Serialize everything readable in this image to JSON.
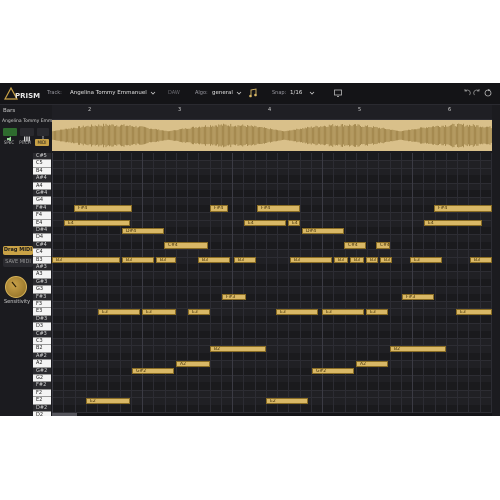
{
  "app": {
    "name": "PRISM"
  },
  "toolbar": {
    "track_label": "Track:",
    "track_value": "Angelina  Tommy Emmanuel",
    "daw_label": "DAW",
    "algo_label": "Algo:",
    "algo_value": "general",
    "snap_label": "Snap:",
    "snap_value": "1/16"
  },
  "sidebar": {
    "bars_label": "Bars",
    "track_name": "Angelina  Tommy Emma...",
    "buttons": [
      "SPEC",
      "PITCH",
      "MIDI"
    ],
    "drag_midi": "Drag MIDI",
    "save_midi": "SAVE MIDI",
    "sensitivity": "Sensitivity"
  },
  "ruler": {
    "marks": [
      "2",
      "3",
      "4",
      "5",
      "6"
    ]
  },
  "piano_keys": [
    "C#5",
    "C5",
    "B4",
    "A#4",
    "A4",
    "G#4",
    "G4",
    "F#4",
    "F4",
    "E4",
    "D#4",
    "D4",
    "C#4",
    "C4",
    "B3",
    "A#3",
    "A3",
    "G#3",
    "G3",
    "F#3",
    "F3",
    "E3",
    "D#3",
    "D3",
    "C#3",
    "C3",
    "B2",
    "A#2",
    "A2",
    "G#2",
    "G2",
    "F#2",
    "F2",
    "E2",
    "D#2",
    "D2"
  ],
  "notes": [
    {
      "label": "F#4",
      "pitch": "F#4",
      "start": 22,
      "len": 58
    },
    {
      "label": "F#4",
      "pitch": "F#4",
      "start": 158,
      "len": 18
    },
    {
      "label": "F#4",
      "pitch": "F#4",
      "start": 205,
      "len": 43
    },
    {
      "label": "F#4",
      "pitch": "F#4",
      "start": 382,
      "len": 58
    },
    {
      "label": "E4",
      "pitch": "E4",
      "start": 12,
      "len": 66
    },
    {
      "label": "E4",
      "pitch": "E4",
      "start": 192,
      "len": 42
    },
    {
      "label": "E4",
      "pitch": "E4",
      "start": 236,
      "len": 12
    },
    {
      "label": "E4",
      "pitch": "E4",
      "start": 372,
      "len": 58
    },
    {
      "label": "D#4",
      "pitch": "D#4",
      "start": 70,
      "len": 42
    },
    {
      "label": "D#4",
      "pitch": "D#4",
      "start": 250,
      "len": 42
    },
    {
      "label": "C#4",
      "pitch": "C#4",
      "start": 112,
      "len": 44
    },
    {
      "label": "C#4",
      "pitch": "C#4",
      "start": 292,
      "len": 22
    },
    {
      "label": "C#4",
      "pitch": "C#4",
      "start": 324,
      "len": 14
    },
    {
      "label": "B3",
      "pitch": "B3",
      "start": 0,
      "len": 68
    },
    {
      "label": "B3",
      "pitch": "B3",
      "start": 70,
      "len": 32
    },
    {
      "label": "B3",
      "pitch": "B3",
      "start": 104,
      "len": 20
    },
    {
      "label": "B3",
      "pitch": "B3",
      "start": 146,
      "len": 32
    },
    {
      "label": "B3",
      "pitch": "B3",
      "start": 182,
      "len": 22
    },
    {
      "label": "B3",
      "pitch": "B3",
      "start": 238,
      "len": 42
    },
    {
      "label": "B3",
      "pitch": "B3",
      "start": 282,
      "len": 14
    },
    {
      "label": "B3",
      "pitch": "B3",
      "start": 298,
      "len": 14
    },
    {
      "label": "B3",
      "pitch": "B3",
      "start": 314,
      "len": 12
    },
    {
      "label": "B3",
      "pitch": "B3",
      "start": 328,
      "len": 12
    },
    {
      "label": "E3",
      "pitch": "B3",
      "start": 358,
      "len": 32
    },
    {
      "label": "B3",
      "pitch": "B3",
      "start": 418,
      "len": 22
    },
    {
      "label": "F#3",
      "pitch": "F#3",
      "start": 170,
      "len": 24
    },
    {
      "label": "F#3",
      "pitch": "F#3",
      "start": 350,
      "len": 32
    },
    {
      "label": "E3",
      "pitch": "E3",
      "start": 46,
      "len": 42
    },
    {
      "label": "E3",
      "pitch": "E3",
      "start": 90,
      "len": 34
    },
    {
      "label": "E3",
      "pitch": "E3",
      "start": 136,
      "len": 22
    },
    {
      "label": "E3",
      "pitch": "E3",
      "start": 224,
      "len": 42
    },
    {
      "label": "E3",
      "pitch": "E3",
      "start": 270,
      "len": 42
    },
    {
      "label": "E3",
      "pitch": "E3",
      "start": 314,
      "len": 22
    },
    {
      "label": "E3",
      "pitch": "E3",
      "start": 404,
      "len": 36
    },
    {
      "label": "B2",
      "pitch": "B2",
      "start": 158,
      "len": 56
    },
    {
      "label": "B2",
      "pitch": "B2",
      "start": 338,
      "len": 56
    },
    {
      "label": "A2",
      "pitch": "A2",
      "start": 124,
      "len": 34
    },
    {
      "label": "A2",
      "pitch": "A2",
      "start": 304,
      "len": 32
    },
    {
      "label": "G#2",
      "pitch": "G#2",
      "start": 80,
      "len": 42
    },
    {
      "label": "G#2",
      "pitch": "G#2",
      "start": 260,
      "len": 42
    },
    {
      "label": "E2",
      "pitch": "E2",
      "start": 34,
      "len": 44
    },
    {
      "label": "E2",
      "pitch": "E2",
      "start": 214,
      "len": 42
    }
  ]
}
